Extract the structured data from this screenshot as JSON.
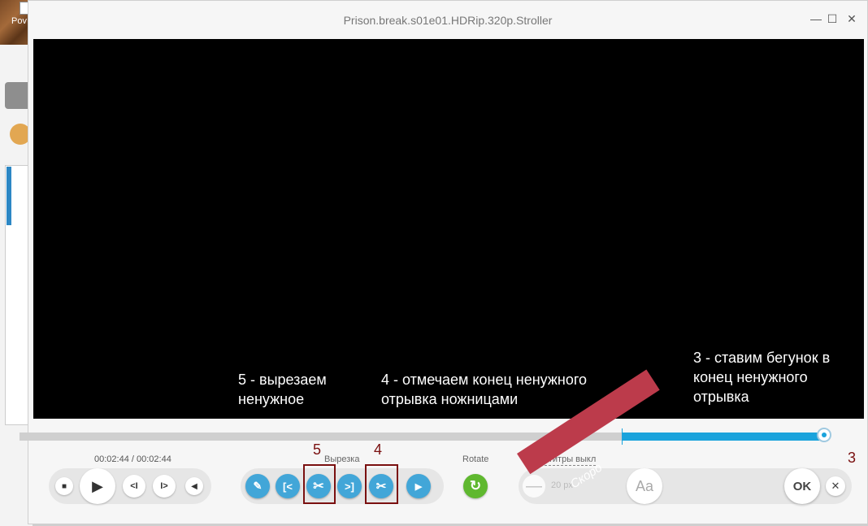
{
  "background_app": {
    "label": "Pov"
  },
  "window": {
    "title": "Prison.break.s01e01.HDRip.320p.Stroller",
    "minimize": "—",
    "maximize": "☐",
    "close": "✕"
  },
  "annotations": {
    "step5": "5 - вырезаем ненужное",
    "step4": "4 - отмечаем конец ненужного отрывка ножницами",
    "step3": "3 - ставим бегунок в конец ненужного отрывка",
    "label5": "5",
    "label4": "4",
    "label3": "3"
  },
  "timeline": {
    "position_fraction": 1.0,
    "selection_start_fraction": 0.748
  },
  "playback": {
    "time": "00:02:44 / 00:02:44",
    "stop_icon": "■",
    "play_icon": "▶",
    "prev_icon": "<I",
    "next_icon": "I>",
    "volume_icon": "◀"
  },
  "cut": {
    "label": "Вырезка",
    "mark_start_icon": "✎",
    "goto_start_icon": "[<",
    "cut_icon": "✂",
    "goto_end_icon": ">]",
    "mark_end_icon": "✂",
    "preview_icon": "▶"
  },
  "rotate": {
    "label": "Rotate",
    "icon": "↻"
  },
  "subtitles": {
    "toggle": "Субтитры выкл",
    "minus": "—",
    "size": "20 px",
    "font_button": "Aa"
  },
  "ribbon": {
    "text": "Скоро"
  },
  "actions": {
    "ok": "OK",
    "close": "✕"
  },
  "colors": {
    "accent": "#1aa3dc",
    "annotation": "#7a1010",
    "rotate": "#5fb82f",
    "ribbon": "#bc3b4b"
  }
}
